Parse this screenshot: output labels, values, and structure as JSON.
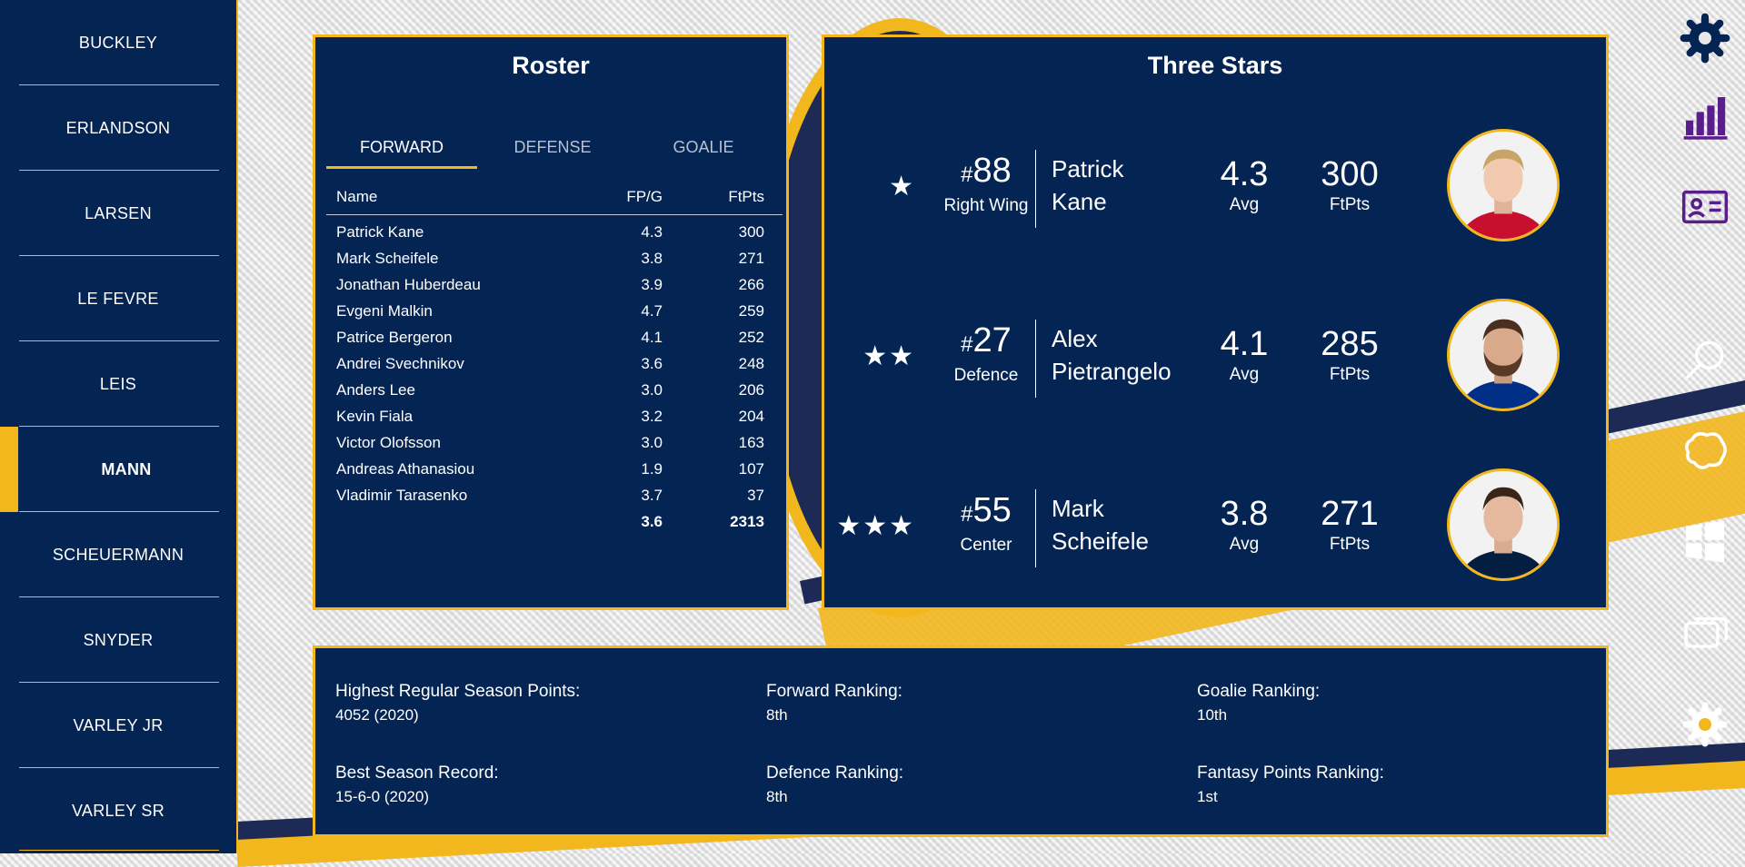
{
  "sidebar": {
    "items": [
      {
        "label": "BUCKLEY"
      },
      {
        "label": "ERLANDSON"
      },
      {
        "label": "LARSEN"
      },
      {
        "label": "LE FEVRE"
      },
      {
        "label": "LEIS"
      },
      {
        "label": "MANN"
      },
      {
        "label": "SCHEUERMANN"
      },
      {
        "label": "SNYDER"
      },
      {
        "label": "VARLEY JR"
      },
      {
        "label": "VARLEY SR"
      }
    ],
    "active_index": 5
  },
  "roster": {
    "title": "Roster",
    "tabs": [
      {
        "label": "FORWARD",
        "active": true
      },
      {
        "label": "DEFENSE",
        "active": false
      },
      {
        "label": "GOALIE",
        "active": false
      }
    ],
    "columns": {
      "name": "Name",
      "fpg": "FP/G",
      "ftpts": "FtPts"
    },
    "rows": [
      {
        "name": "Patrick Kane",
        "fpg": "4.3",
        "ftpts": "300"
      },
      {
        "name": "Mark Scheifele",
        "fpg": "3.8",
        "ftpts": "271"
      },
      {
        "name": "Jonathan Huberdeau",
        "fpg": "3.9",
        "ftpts": "266"
      },
      {
        "name": "Evgeni Malkin",
        "fpg": "4.7",
        "ftpts": "259"
      },
      {
        "name": "Patrice Bergeron",
        "fpg": "4.1",
        "ftpts": "252"
      },
      {
        "name": "Andrei Svechnikov",
        "fpg": "3.6",
        "ftpts": "248"
      },
      {
        "name": "Anders Lee",
        "fpg": "3.0",
        "ftpts": "206"
      },
      {
        "name": "Kevin Fiala",
        "fpg": "3.2",
        "ftpts": "204"
      },
      {
        "name": "Victor Olofsson",
        "fpg": "3.0",
        "ftpts": "163"
      },
      {
        "name": "Andreas Athanasiou",
        "fpg": "1.9",
        "ftpts": "107"
      },
      {
        "name": "Vladimir Tarasenko",
        "fpg": "3.7",
        "ftpts": "37"
      }
    ],
    "total": {
      "fpg": "3.6",
      "ftpts": "2313"
    }
  },
  "three_stars": {
    "title": "Three Stars",
    "players": [
      {
        "stars": "★",
        "hash": "#",
        "number": "88",
        "position": "Right Wing",
        "first": "Patrick",
        "last": "Kane",
        "avg": "4.3",
        "avg_label": "Avg",
        "ftpts": "300",
        "ftpts_label": "FtPts",
        "jersey_color": "#c8102e"
      },
      {
        "stars": "★★",
        "hash": "#",
        "number": "27",
        "position": "Defence",
        "first": "Alex",
        "last": "Pietrangelo",
        "avg": "4.1",
        "avg_label": "Avg",
        "ftpts": "285",
        "ftpts_label": "FtPts",
        "jersey_color": "#002f87"
      },
      {
        "stars": "★★★",
        "hash": "#",
        "number": "55",
        "position": "Center",
        "first": "Mark",
        "last": "Scheifele",
        "avg": "3.8",
        "avg_label": "Avg",
        "ftpts": "271",
        "ftpts_label": "FtPts",
        "jersey_color": "#041e42"
      }
    ]
  },
  "summary": {
    "items": [
      {
        "label": "Highest Regular Season Points:",
        "value": "4052 (2020)"
      },
      {
        "label": "Forward Ranking:",
        "value": "8th"
      },
      {
        "label": "Goalie Ranking:",
        "value": "10th"
      },
      {
        "label": "Best Season Record:",
        "value": "15-6-0 (2020)"
      },
      {
        "label": "Defence Ranking:",
        "value": "8th"
      },
      {
        "label": "Fantasy Points Ranking:",
        "value": "1st"
      }
    ]
  },
  "right_icons": [
    {
      "name": "settings-icon",
      "color": "#042454"
    },
    {
      "name": "bar-chart-icon",
      "color": "#5a1d8c"
    },
    {
      "name": "id-card-icon",
      "color": "#5a1d8c"
    },
    {
      "name": "search-icon",
      "color": "#ffffff"
    },
    {
      "name": "brain-icon",
      "color": "#ffffff"
    },
    {
      "name": "windows-icon",
      "color": "#ffffff"
    },
    {
      "name": "toggle-icon",
      "color": "#ffffff"
    },
    {
      "name": "gear-icon",
      "color": "#ffffff"
    }
  ],
  "colors": {
    "navy": "#042454",
    "gold": "#f3b71e"
  }
}
